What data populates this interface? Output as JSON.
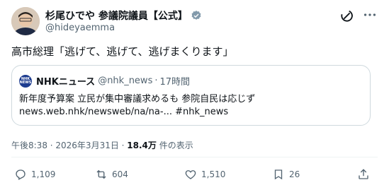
{
  "author": {
    "name": "杉尾ひでや 参議院議員【公式】",
    "handle": "@hideyaemma"
  },
  "tweet": {
    "text": "高市総理「逃げて、逃げて、逃げまくります」"
  },
  "quote": {
    "logo_text_top": "NHK",
    "logo_text_bottom": "NEWS",
    "name": "NHKニュース",
    "handle": "@nhk_news",
    "separator": "·",
    "time": "17時間",
    "line1": "新年度予算案 立民が集中審議求めるも 参院自民は応じず",
    "line2": "news.web.nhk/newsweb/na/na-... #nhk_news"
  },
  "meta": {
    "time": "午後8:38 · 2026年3月31日 · ",
    "views_count": "18.4万",
    "views_label": " 件の表示"
  },
  "actions": {
    "reply": "1,109",
    "repost": "604",
    "like": "1,510",
    "bookmark": "26"
  },
  "colors": {
    "text": "#0f1419",
    "muted": "#536471",
    "verified": "#829aab",
    "border": "#cfd9de"
  }
}
